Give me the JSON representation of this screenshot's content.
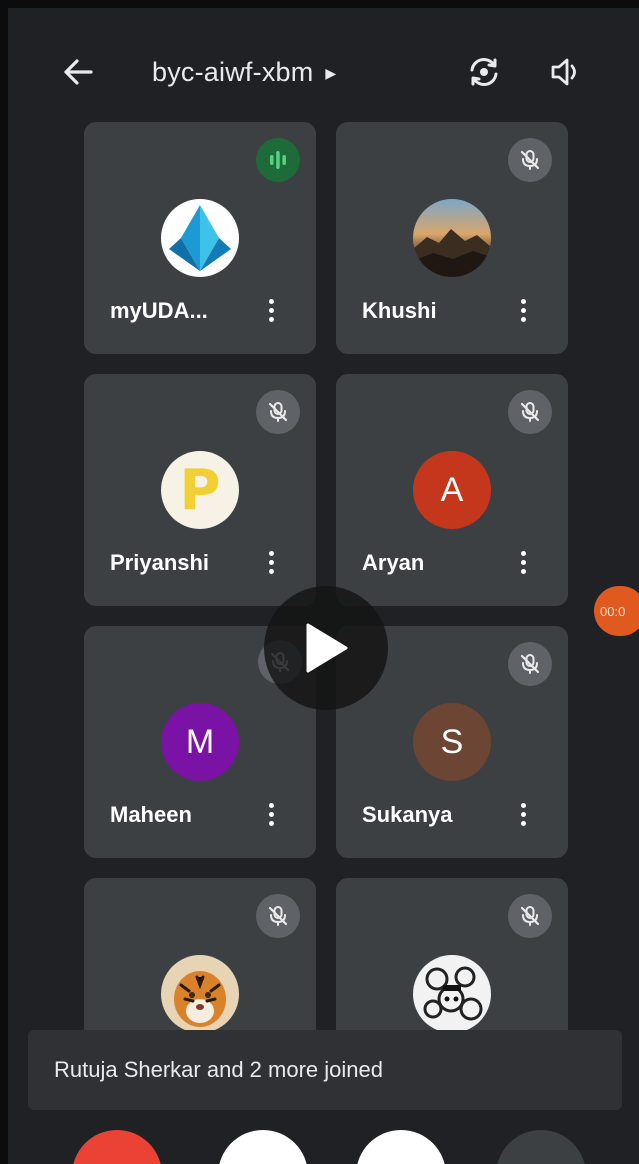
{
  "header": {
    "meeting_code": "byc-aiwf-xbm",
    "icons": {
      "back": "arrow-left-icon",
      "switch_camera": "switch-camera-icon",
      "audio": "speaker-icon"
    }
  },
  "participants": [
    {
      "name": "myUDA...",
      "avatar": "logo",
      "mic": "speaking"
    },
    {
      "name": "Khushi",
      "avatar": "photo",
      "mic": "muted"
    },
    {
      "name": "Priyanshi",
      "avatar": "P",
      "mic": "muted"
    },
    {
      "name": "Aryan",
      "avatar": "A",
      "avatar_color": "#c5371d",
      "mic": "muted"
    },
    {
      "name": "Maheen",
      "avatar": "M",
      "avatar_color": "#7b12a6",
      "mic": "muted"
    },
    {
      "name": "Sukanya",
      "avatar": "S",
      "avatar_color": "#6d4535",
      "mic": "muted"
    },
    {
      "name": "",
      "avatar": "photo",
      "mic": "muted"
    },
    {
      "name": "",
      "avatar": "photo",
      "mic": "muted"
    }
  ],
  "recording_timer": "00:0",
  "toast": {
    "message": "Rutuja Sherkar and 2 more joined"
  },
  "controls": {
    "end_call_color": "#ea4335"
  }
}
